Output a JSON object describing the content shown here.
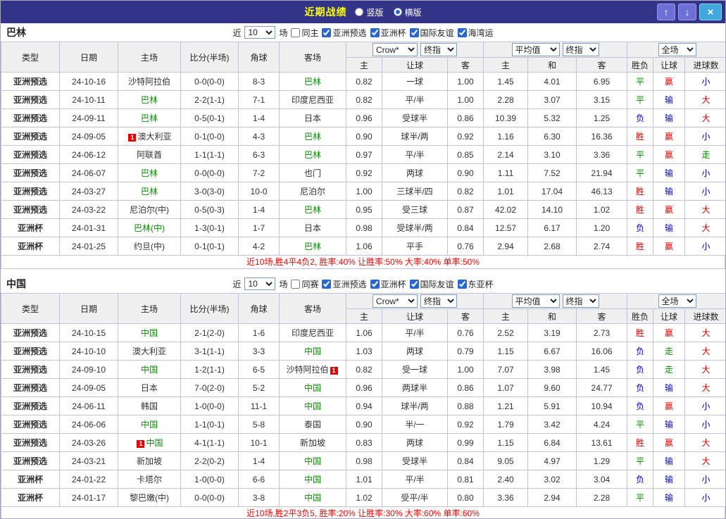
{
  "titlebar": {
    "title": "近期战绩",
    "view_options": [
      {
        "label": "竖版",
        "selected": false
      },
      {
        "label": "横版",
        "selected": true
      }
    ],
    "buttons": {
      "up": "↑",
      "down": "↓",
      "close": "×"
    }
  },
  "table_headers": {
    "left": [
      "类型",
      "日期",
      "主场",
      "比分(半场)",
      "角球",
      "客场"
    ],
    "groups": [
      {
        "selects": [
          "Crow*",
          "终指"
        ],
        "cols": [
          "主",
          "让球",
          "客"
        ]
      },
      {
        "selects": [
          "平均值",
          "终指"
        ],
        "cols": [
          "主",
          "和",
          "客"
        ]
      },
      {
        "selects": [
          "全场"
        ],
        "cols": [
          "胜负",
          "让球",
          "进球数"
        ]
      }
    ]
  },
  "colors": {
    "titlebar_bg": "#333388",
    "title_color": "#ffff00",
    "type_class": {
      "亚洲预选": "type-dark",
      "亚洲杯": "type-light"
    },
    "type_hex": {
      "type-dark": "#2db32d",
      "type-light": "#57cd57"
    },
    "result_class": {
      "胜": "red",
      "平": "green",
      "负": "blue",
      "赢": "red",
      "输": "blue",
      "走": "green",
      "大": "red",
      "小": "blue"
    },
    "self_team_color": "#089000",
    "score_color": "#e60000",
    "summary_color": "#ff0000"
  },
  "sections": [
    {
      "team": "巴林",
      "filter": {
        "prefix": "近",
        "count": "10",
        "suffix": "场",
        "same": {
          "label": "同主",
          "checked": false
        },
        "leagues": [
          {
            "label": "亚洲预选",
            "checked": true
          },
          {
            "label": "亚洲杯",
            "checked": true
          },
          {
            "label": "国际友谊",
            "checked": true
          },
          {
            "label": "海湾运",
            "checked": true
          }
        ]
      },
      "rows": [
        {
          "type": "亚洲预选",
          "date": "24-10-16",
          "home": "沙特阿拉伯",
          "home_self": false,
          "home_badge": "",
          "score": "0-0(0-0)",
          "corners": "8-3",
          "away": "巴林",
          "away_self": true,
          "away_badge": "",
          "odds_home": "0.82",
          "handicap": "一球",
          "odds_away": "1.00",
          "avg_home": "1.45",
          "avg_draw": "4.01",
          "avg_away": "6.95",
          "result": "平",
          "let_result": "赢",
          "goal_result": "小"
        },
        {
          "type": "亚洲预选",
          "date": "24-10-11",
          "home": "巴林",
          "home_self": true,
          "home_badge": "",
          "score": "2-2(1-1)",
          "corners": "7-1",
          "away": "印度尼西亚",
          "away_self": false,
          "away_badge": "",
          "odds_home": "0.82",
          "handicap": "平/半",
          "odds_away": "1.00",
          "avg_home": "2.28",
          "avg_draw": "3.07",
          "avg_away": "3.15",
          "result": "平",
          "let_result": "输",
          "goal_result": "大"
        },
        {
          "type": "亚洲预选",
          "date": "24-09-11",
          "home": "巴林",
          "home_self": true,
          "home_badge": "",
          "score": "0-5(0-1)",
          "corners": "1-4",
          "away": "日本",
          "away_self": false,
          "away_badge": "",
          "odds_home": "0.96",
          "handicap": "受球半",
          "odds_away": "0.86",
          "avg_home": "10.39",
          "avg_draw": "5.32",
          "avg_away": "1.25",
          "result": "负",
          "let_result": "输",
          "goal_result": "大"
        },
        {
          "type": "亚洲预选",
          "date": "24-09-05",
          "home": "澳大利亚",
          "home_self": false,
          "home_badge": "1",
          "score": "0-1(0-0)",
          "corners": "4-3",
          "away": "巴林",
          "away_self": true,
          "away_badge": "",
          "odds_home": "0.90",
          "handicap": "球半/两",
          "odds_away": "0.92",
          "avg_home": "1.16",
          "avg_draw": "6.30",
          "avg_away": "16.36",
          "result": "胜",
          "let_result": "赢",
          "goal_result": "小"
        },
        {
          "type": "亚洲预选",
          "date": "24-06-12",
          "home": "阿联酋",
          "home_self": false,
          "home_badge": "",
          "score": "1-1(1-1)",
          "corners": "6-3",
          "away": "巴林",
          "away_self": true,
          "away_badge": "",
          "odds_home": "0.97",
          "handicap": "平/半",
          "odds_away": "0.85",
          "avg_home": "2.14",
          "avg_draw": "3.10",
          "avg_away": "3.36",
          "result": "平",
          "let_result": "赢",
          "goal_result": "走"
        },
        {
          "type": "亚洲预选",
          "date": "24-06-07",
          "home": "巴林",
          "home_self": true,
          "home_badge": "",
          "score": "0-0(0-0)",
          "corners": "7-2",
          "away": "也门",
          "away_self": false,
          "away_badge": "",
          "odds_home": "0.92",
          "handicap": "两球",
          "odds_away": "0.90",
          "avg_home": "1.11",
          "avg_draw": "7.52",
          "avg_away": "21.94",
          "result": "平",
          "let_result": "输",
          "goal_result": "小"
        },
        {
          "type": "亚洲预选",
          "date": "24-03-27",
          "home": "巴林",
          "home_self": true,
          "home_badge": "",
          "score": "3-0(3-0)",
          "corners": "10-0",
          "away": "尼泊尔",
          "away_self": false,
          "away_badge": "",
          "odds_home": "1.00",
          "handicap": "三球半/四",
          "odds_away": "0.82",
          "avg_home": "1.01",
          "avg_draw": "17.04",
          "avg_away": "46.13",
          "result": "胜",
          "let_result": "输",
          "goal_result": "小"
        },
        {
          "type": "亚洲预选",
          "date": "24-03-22",
          "home": "尼泊尔(中)",
          "home_self": false,
          "home_badge": "",
          "score": "0-5(0-3)",
          "corners": "1-4",
          "away": "巴林",
          "away_self": true,
          "away_badge": "",
          "odds_home": "0.95",
          "handicap": "受三球",
          "odds_away": "0.87",
          "avg_home": "42.02",
          "avg_draw": "14.10",
          "avg_away": "1.02",
          "result": "胜",
          "let_result": "赢",
          "goal_result": "大"
        },
        {
          "type": "亚洲杯",
          "date": "24-01-31",
          "home": "巴林(中)",
          "home_self": true,
          "home_badge": "",
          "score": "1-3(0-1)",
          "corners": "1-7",
          "away": "日本",
          "away_self": false,
          "away_badge": "",
          "odds_home": "0.98",
          "handicap": "受球半/两",
          "odds_away": "0.84",
          "avg_home": "12.57",
          "avg_draw": "6.17",
          "avg_away": "1.20",
          "result": "负",
          "let_result": "输",
          "goal_result": "大"
        },
        {
          "type": "亚洲杯",
          "date": "24-01-25",
          "home": "约旦(中)",
          "home_self": false,
          "home_badge": "",
          "score": "0-1(0-1)",
          "corners": "4-2",
          "away": "巴林",
          "away_self": true,
          "away_badge": "",
          "odds_home": "1.06",
          "handicap": "平手",
          "odds_away": "0.76",
          "avg_home": "2.94",
          "avg_draw": "2.68",
          "avg_away": "2.74",
          "result": "胜",
          "let_result": "赢",
          "goal_result": "小"
        }
      ],
      "summary": "近10场,胜4平4负2, 胜率:40% 让胜率:50% 大率:40% 单率:50%"
    },
    {
      "team": "中国",
      "filter": {
        "prefix": "近",
        "count": "10",
        "suffix": "场",
        "same": {
          "label": "同赛",
          "checked": false
        },
        "leagues": [
          {
            "label": "亚洲预选",
            "checked": true
          },
          {
            "label": "亚洲杯",
            "checked": true
          },
          {
            "label": "国际友谊",
            "checked": true
          },
          {
            "label": "东亚杯",
            "checked": true
          }
        ]
      },
      "rows": [
        {
          "type": "亚洲预选",
          "date": "24-10-15",
          "home": "中国",
          "home_self": true,
          "home_badge": "",
          "score": "2-1(2-0)",
          "corners": "1-6",
          "away": "印度尼西亚",
          "away_self": false,
          "away_badge": "",
          "odds_home": "1.06",
          "handicap": "平/半",
          "odds_away": "0.76",
          "avg_home": "2.52",
          "avg_draw": "3.19",
          "avg_away": "2.73",
          "result": "胜",
          "let_result": "赢",
          "goal_result": "大"
        },
        {
          "type": "亚洲预选",
          "date": "24-10-10",
          "home": "澳大利亚",
          "home_self": false,
          "home_badge": "",
          "score": "3-1(1-1)",
          "corners": "3-3",
          "away": "中国",
          "away_self": true,
          "away_badge": "",
          "odds_home": "1.03",
          "handicap": "两球",
          "odds_away": "0.79",
          "avg_home": "1.15",
          "avg_draw": "6.67",
          "avg_away": "16.06",
          "result": "负",
          "let_result": "走",
          "goal_result": "大"
        },
        {
          "type": "亚洲预选",
          "date": "24-09-10",
          "home": "中国",
          "home_self": true,
          "home_badge": "",
          "score": "1-2(1-1)",
          "corners": "6-5",
          "away": "沙特阿拉伯",
          "away_self": false,
          "away_badge": "1",
          "odds_home": "0.82",
          "handicap": "受一球",
          "odds_away": "1.00",
          "avg_home": "7.07",
          "avg_draw": "3.98",
          "avg_away": "1.45",
          "result": "负",
          "let_result": "走",
          "goal_result": "大"
        },
        {
          "type": "亚洲预选",
          "date": "24-09-05",
          "home": "日本",
          "home_self": false,
          "home_badge": "",
          "score": "7-0(2-0)",
          "corners": "5-2",
          "away": "中国",
          "away_self": true,
          "away_badge": "",
          "odds_home": "0.96",
          "handicap": "两球半",
          "odds_away": "0.86",
          "avg_home": "1.07",
          "avg_draw": "9.60",
          "avg_away": "24.77",
          "result": "负",
          "let_result": "输",
          "goal_result": "大"
        },
        {
          "type": "亚洲预选",
          "date": "24-06-11",
          "home": "韩国",
          "home_self": false,
          "home_badge": "",
          "score": "1-0(0-0)",
          "corners": "11-1",
          "away": "中国",
          "away_self": true,
          "away_badge": "",
          "odds_home": "0.94",
          "handicap": "球半/两",
          "odds_away": "0.88",
          "avg_home": "1.21",
          "avg_draw": "5.91",
          "avg_away": "10.94",
          "result": "负",
          "let_result": "赢",
          "goal_result": "小"
        },
        {
          "type": "亚洲预选",
          "date": "24-06-06",
          "home": "中国",
          "home_self": true,
          "home_badge": "",
          "score": "1-1(0-1)",
          "corners": "5-8",
          "away": "泰国",
          "away_self": false,
          "away_badge": "",
          "odds_home": "0.90",
          "handicap": "半/一",
          "odds_away": "0.92",
          "avg_home": "1.79",
          "avg_draw": "3.42",
          "avg_away": "4.24",
          "result": "平",
          "let_result": "输",
          "goal_result": "小"
        },
        {
          "type": "亚洲预选",
          "date": "24-03-26",
          "home": "中国",
          "home_self": true,
          "home_badge": "1",
          "score": "4-1(1-1)",
          "corners": "10-1",
          "away": "新加坡",
          "away_self": false,
          "away_badge": "",
          "odds_home": "0.83",
          "handicap": "两球",
          "odds_away": "0.99",
          "avg_home": "1.15",
          "avg_draw": "6.84",
          "avg_away": "13.61",
          "result": "胜",
          "let_result": "赢",
          "goal_result": "大"
        },
        {
          "type": "亚洲预选",
          "date": "24-03-21",
          "home": "新加坡",
          "home_self": false,
          "home_badge": "",
          "score": "2-2(0-2)",
          "corners": "1-4",
          "away": "中国",
          "away_self": true,
          "away_badge": "",
          "odds_home": "0.98",
          "handicap": "受球半",
          "odds_away": "0.84",
          "avg_home": "9.05",
          "avg_draw": "4.97",
          "avg_away": "1.29",
          "result": "平",
          "let_result": "输",
          "goal_result": "大"
        },
        {
          "type": "亚洲杯",
          "date": "24-01-22",
          "home": "卡塔尔",
          "home_self": false,
          "home_badge": "",
          "score": "1-0(0-0)",
          "corners": "6-6",
          "away": "中国",
          "away_self": true,
          "away_badge": "",
          "odds_home": "1.01",
          "handicap": "平/半",
          "odds_away": "0.81",
          "avg_home": "2.40",
          "avg_draw": "3.02",
          "avg_away": "3.04",
          "result": "负",
          "let_result": "输",
          "goal_result": "小"
        },
        {
          "type": "亚洲杯",
          "date": "24-01-17",
          "home": "黎巴嫩(中)",
          "home_self": false,
          "home_badge": "",
          "score": "0-0(0-0)",
          "corners": "3-8",
          "away": "中国",
          "away_self": true,
          "away_badge": "",
          "odds_home": "1.02",
          "handicap": "受平/半",
          "odds_away": "0.80",
          "avg_home": "3.36",
          "avg_draw": "2.94",
          "avg_away": "2.28",
          "result": "平",
          "let_result": "输",
          "goal_result": "小"
        }
      ],
      "summary": "近10场,胜2平3负5, 胜率:20% 让胜率:30% 大率:60% 单率:60%"
    }
  ]
}
